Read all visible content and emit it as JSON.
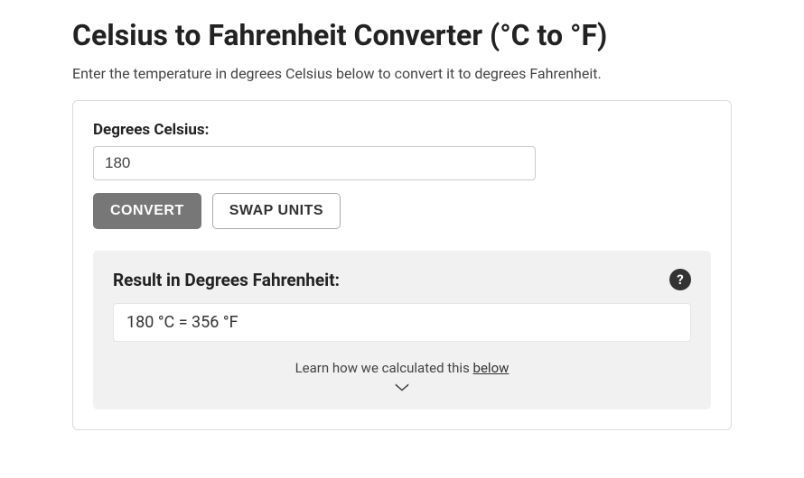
{
  "page": {
    "title": "Celsius to Fahrenheit Converter (°C to °F)",
    "subtitle": "Enter the temperature in degrees Celsius below to convert it to degrees Fahrenheit."
  },
  "form": {
    "input_label": "Degrees Celsius:",
    "input_value": "180",
    "convert_label": "CONVERT",
    "swap_label": "SWAP UNITS"
  },
  "result": {
    "title": "Result in Degrees Fahrenheit:",
    "output": "180 °C = 356 °F",
    "learn_prefix": "Learn how we calculated this ",
    "learn_link": "below",
    "help_icon": "?"
  }
}
